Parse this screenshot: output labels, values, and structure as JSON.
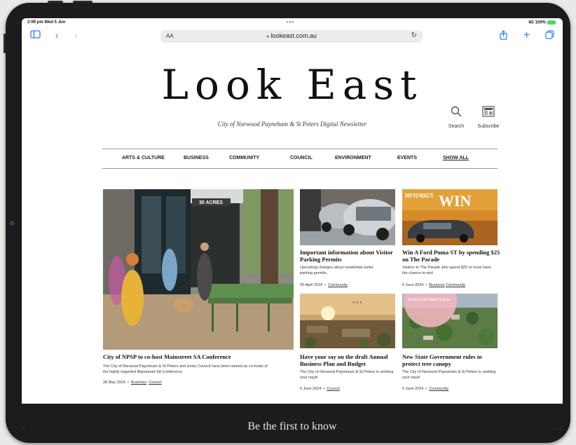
{
  "status_bar": {
    "time": "2:09 pm  Wed 5 Jun",
    "dots": "•••",
    "signal": "4G 100%"
  },
  "browser": {
    "text_size": "AA",
    "url": "lookeast.com.au"
  },
  "masthead": {
    "title": "Look East",
    "subtitle": "City of Norwood Payneham & St Peters Digital Newsletter",
    "search": "Search",
    "subscribe": "Subscribe"
  },
  "nav": {
    "items": [
      "ARTS & CULTURE",
      "BUSINESS",
      "COMMUNITY",
      "COUNCIL",
      "ENVIRONMENT",
      "EVENTS",
      "SHOW ALL"
    ]
  },
  "articles": [
    {
      "title": "City of NPSP to co-host Mainstreet SA Conference",
      "excerpt": "The City of Norwood Payneham & St Peters and Unley Council have been named as co-hosts of the highly regarded Mainstreet SA Conference.",
      "date": "28 May 2024",
      "tags": [
        "Business",
        "Council"
      ],
      "image_text": "30 ACRES"
    },
    {
      "title": "Important information about Visitor Parking Permits",
      "excerpt": "Upcoming changes about residential visitor parking permits.",
      "date": "30 April 2024",
      "tags": [
        "Community"
      ]
    },
    {
      "title": "Win A Ford Puma ST by spending $25 on The Parade",
      "excerpt": "Visitors to The Parade who spend $25 or more have the chance to win!",
      "date": "5 June 2024",
      "tags": [
        "Business",
        "Community"
      ],
      "image_text": "SHOP THE PARADE TO",
      "image_win": "WIN"
    },
    {
      "title": "Have your say on the draft Annual Business Plan and Budget",
      "excerpt": "The City of Norwood Payneham & St Peters is seeking your input!",
      "date": "5 June 2024",
      "tags": [
        "Council"
      ]
    },
    {
      "title": "New State Government rules to protect tree canopy",
      "excerpt": "The City of Norwood Payneham & St Peters is seeking your input!",
      "date": "5 June 2024",
      "tags": [
        "Community"
      ],
      "image_text": "New rules to protect Adelaide's tree canopy"
    }
  ],
  "footer": {
    "text": "Be the first to know"
  }
}
